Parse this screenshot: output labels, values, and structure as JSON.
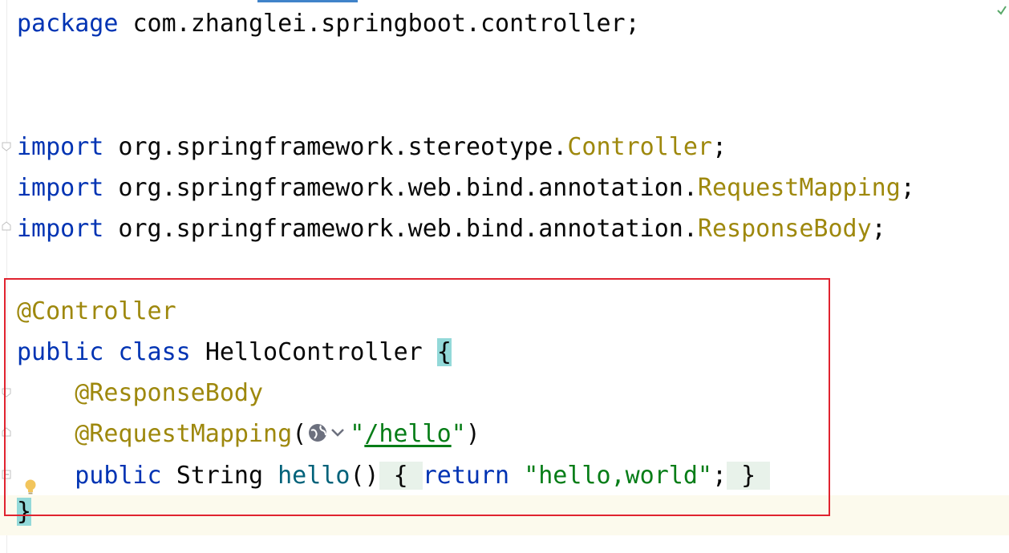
{
  "code": {
    "package_kw": "package",
    "package_name": " com.zhanglei.springboot.controller;",
    "imports": [
      {
        "kw": "import",
        "path": " org.springframework.stereotype.",
        "cls": "Controller",
        "end": ";"
      },
      {
        "kw": "import",
        "path": " org.springframework.web.bind.annotation.",
        "cls": "RequestMapping",
        "end": ";"
      },
      {
        "kw": "import",
        "path": " org.springframework.web.bind.annotation.",
        "cls": "ResponseBody",
        "end": ";"
      }
    ],
    "class_annotation": "@Controller",
    "class_decl": {
      "public_kw": "public",
      "class_kw": "class",
      "name": "HelloController",
      "open_brace": "{"
    },
    "method_annotation_1": "@ResponseBody",
    "method_annotation_2": {
      "name": "@RequestMapping",
      "open_paren": "(",
      "quote_open": "\"",
      "path": "/hello",
      "quote_close": "\"",
      "close_paren": ")"
    },
    "method": {
      "public_kw": "public",
      "return_type": "String",
      "name": "hello",
      "parens": "()",
      "open_brace": "{",
      "return_kw": "return",
      "value": "\"hello,world\"",
      "semicolon": ";",
      "close_brace": "}"
    },
    "class_close": "}"
  },
  "icons": {
    "gutter_check": "check-icon",
    "url_globe": "globe-icon",
    "intention": "lightbulb-icon"
  },
  "colors": {
    "keyword": "#0033b3",
    "annotation": "#9e880d",
    "string": "#067d17",
    "method": "#00627a",
    "highlight_box": "#e0232f"
  }
}
